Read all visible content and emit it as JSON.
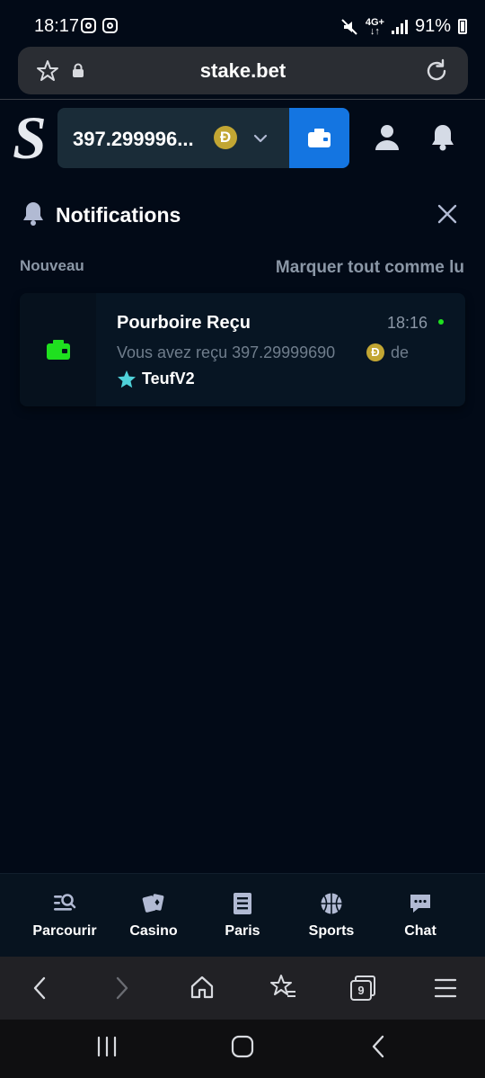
{
  "status_bar": {
    "time": "18:17",
    "network": "4G+",
    "battery": "91%"
  },
  "browser": {
    "url": "stake.bet",
    "tabs_count": "9"
  },
  "header": {
    "balance": "397.299996...",
    "currency_symbol": "Ð"
  },
  "notifications": {
    "title": "Notifications",
    "section_label": "Nouveau",
    "mark_all_label": "Marquer tout comme lu",
    "items": [
      {
        "title": "Pourboire Reçu",
        "time": "18:16",
        "message": "Vous avez reçu 397.29999690",
        "currency_symbol": "Ð",
        "suffix": "de",
        "user": "TeufV2"
      }
    ]
  },
  "bottom_nav": {
    "items": [
      {
        "label": "Parcourir"
      },
      {
        "label": "Casino"
      },
      {
        "label": "Paris"
      },
      {
        "label": "Sports"
      },
      {
        "label": "Chat"
      }
    ]
  },
  "colors": {
    "background": "#020a17",
    "wallet_accent": "#1475e1",
    "coin": "#c2a633",
    "online_dot": "#1fe01f",
    "wallet_icon_green": "#1fe01f"
  }
}
